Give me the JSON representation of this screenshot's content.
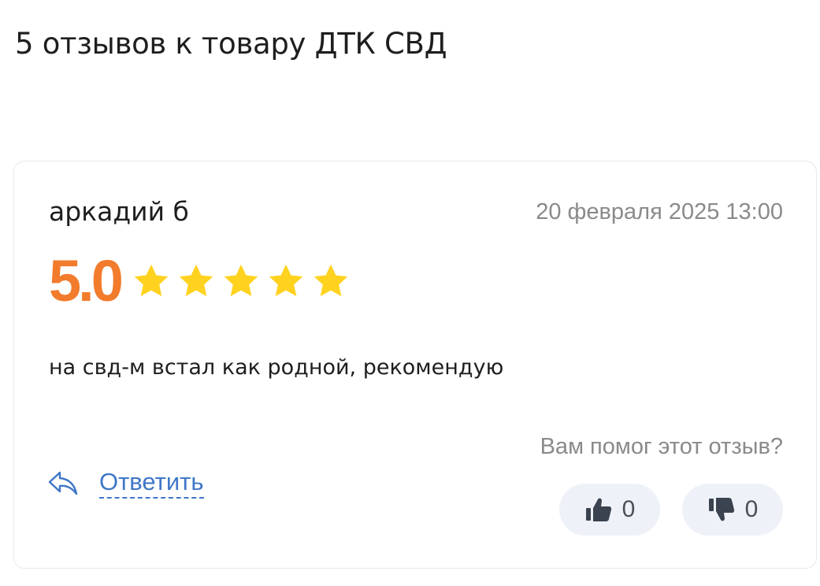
{
  "page": {
    "title": "5 отзывов к товару ДТК СВД"
  },
  "review": {
    "author": "аркадий б",
    "date": "20 февраля 2025 13:00",
    "rating": "5.0",
    "rating_stars": 5,
    "text": "на свд-м встал как родной, рекомендую",
    "helpful_question": "Вам помог этот отзыв?",
    "reply_label": "Ответить",
    "likes": "0",
    "dislikes": "0"
  },
  "colors": {
    "rating": "#f27b2c",
    "star": "#ffd21f",
    "link": "#3f77c7",
    "muted": "#8a8a8a",
    "vote_bg": "#eef2f8"
  },
  "icons": {
    "reply": "reply-arrow-icon",
    "like": "thumbs-up-icon",
    "dislike": "thumbs-down-icon",
    "star": "star-icon"
  }
}
